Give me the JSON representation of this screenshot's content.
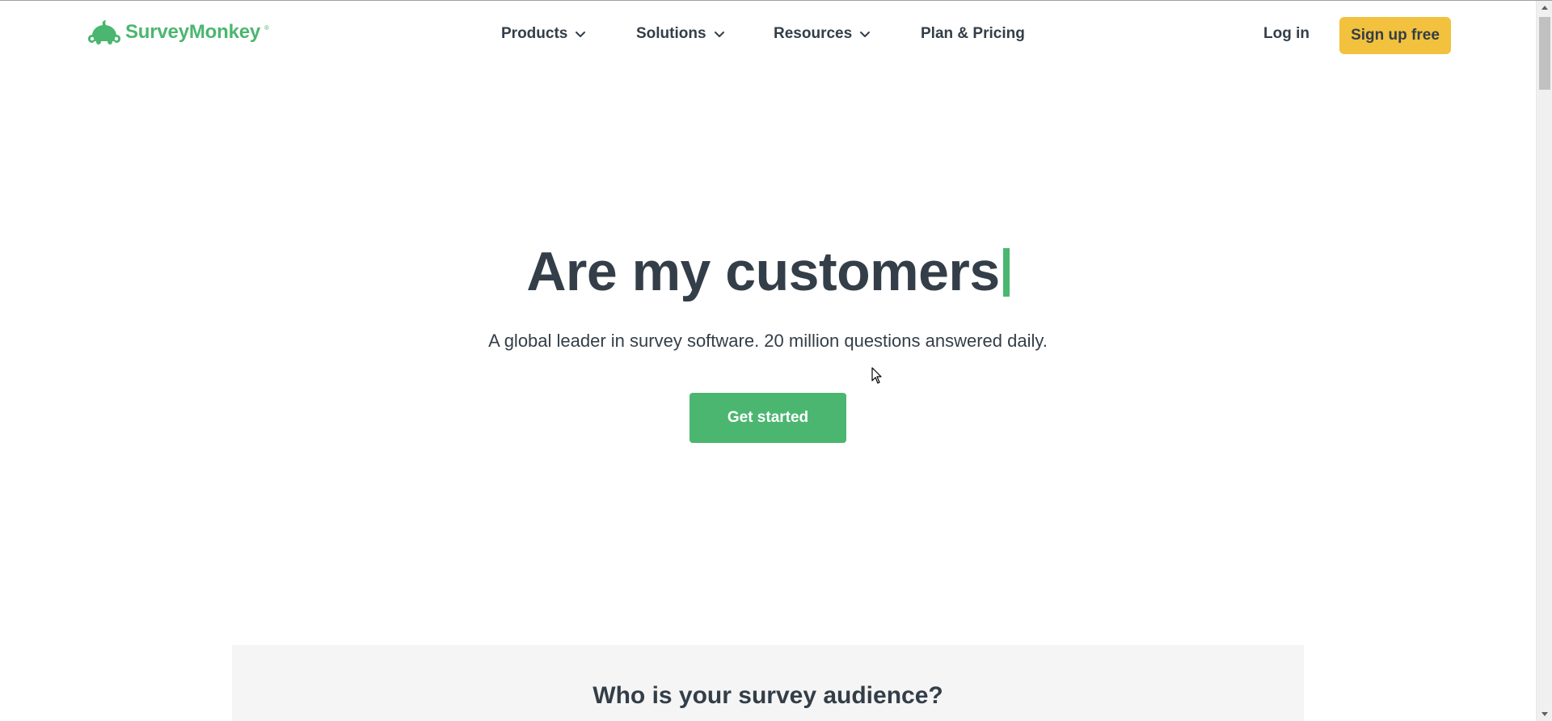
{
  "brand": {
    "name": "SurveyMonkey",
    "registered": "®",
    "color": "#4bb66f"
  },
  "nav": {
    "products": "Products",
    "solutions": "Solutions",
    "resources": "Resources",
    "pricing": "Plan & Pricing"
  },
  "auth": {
    "login": "Log in",
    "signup": "Sign up free"
  },
  "hero": {
    "title": "Are my customers",
    "subtitle": "A global leader in survey software. 20 million questions answered daily.",
    "cta": "Get started"
  },
  "audience": {
    "title": "Who is your survey audience?"
  },
  "colors": {
    "text": "#333e48",
    "accent_green": "#4bb66f",
    "signup_yellow": "#f2c13d",
    "section_gray": "#f5f5f5"
  },
  "icons": {
    "logo": "monkey-logo-icon",
    "dropdown": "chevron-down-icon",
    "cursor": "mouse-pointer-icon"
  }
}
